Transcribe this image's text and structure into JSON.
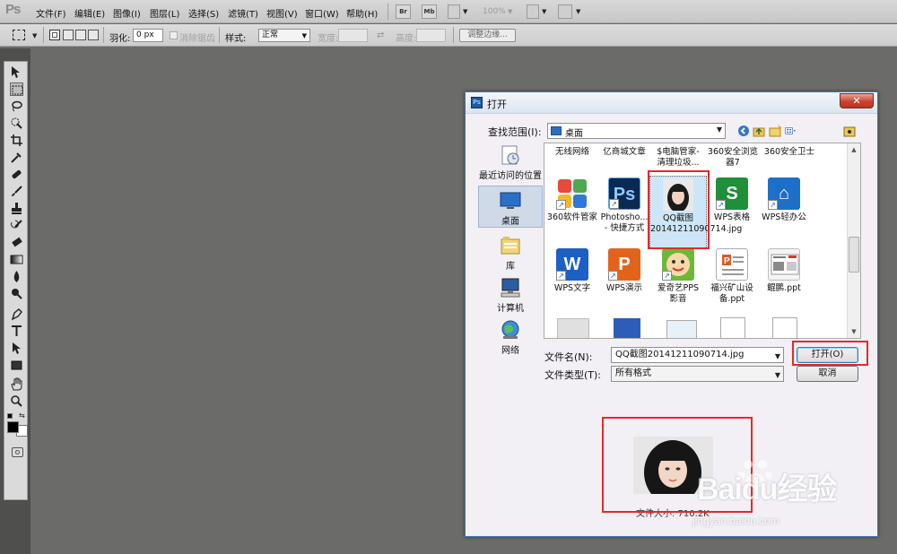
{
  "app": {
    "logo": "Ps"
  },
  "menu": {
    "items": [
      "文件(F)",
      "编辑(E)",
      "图像(I)",
      "图层(L)",
      "选择(S)",
      "滤镜(T)",
      "视图(V)",
      "窗口(W)",
      "帮助(H)"
    ],
    "bridge_label": "Br",
    "minibridge_label": "Mb",
    "zoom": "100%"
  },
  "options": {
    "feather_label": "羽化:",
    "feather_value": "0 px",
    "antialias_label": "消除锯齿",
    "style_label": "样式:",
    "style_value": "正常",
    "width_label": "宽度:",
    "height_label": "高度:",
    "refine_edge_label": "调整边缘..."
  },
  "dialog": {
    "title": "打开",
    "close": "✕",
    "ps_icon": "Ps",
    "lookin_label": "查找范围(I):",
    "lookin_value": "桌面",
    "places": [
      {
        "label": "最近访问的位置",
        "icon": "recent-places-icon"
      },
      {
        "label": "桌面",
        "icon": "desktop-icon"
      },
      {
        "label": "库",
        "icon": "libraries-icon"
      },
      {
        "label": "计算机",
        "icon": "computer-icon"
      },
      {
        "label": "网络",
        "icon": "network-icon"
      }
    ],
    "files_top_row": [
      "无线网络",
      "亿商城文章",
      "$电脑管家-\n清理垃圾...",
      "360安全浏览\n器7",
      "360安全卫士"
    ],
    "files": [
      {
        "label": "360软件管家",
        "icon": "360-software-manager-icon"
      },
      {
        "label": "Photosho...\n- 快捷方式",
        "icon": "photoshop-icon"
      },
      {
        "label": "QQ截图\n20141211090714.jpg",
        "icon": "photo-thumbnail-icon"
      },
      {
        "label": "WPS表格",
        "icon": "wps-spreadsheet-icon"
      },
      {
        "label": "WPS轻办公",
        "icon": "wps-lite-office-icon"
      },
      {
        "label": "WPS文字",
        "icon": "wps-writer-icon"
      },
      {
        "label": "WPS演示",
        "icon": "wps-presentation-icon"
      },
      {
        "label": "爱奇艺PPS\n影音",
        "icon": "iqiyi-pps-icon"
      },
      {
        "label": "福兴矿山设\n备.ppt",
        "icon": "ppt-document-icon"
      },
      {
        "label": "鲲鹏.ppt",
        "icon": "ppt-thumbnail-icon"
      }
    ],
    "filename_label": "文件名(N):",
    "filename_value": "QQ截图20141211090714.jpg",
    "filetype_label": "文件类型(T):",
    "filetype_value": "所有格式",
    "open_button": "打开(O)",
    "cancel_button": "取消",
    "preview_size": "文件大小: 710.2K"
  },
  "watermark": {
    "text": "Baidu经验",
    "url": "jingyan.baidu.com"
  },
  "colors": {
    "red_highlight": "#e22a2a",
    "workspace": "#6b6c69",
    "dialog_bg": "#f2f0f5"
  }
}
